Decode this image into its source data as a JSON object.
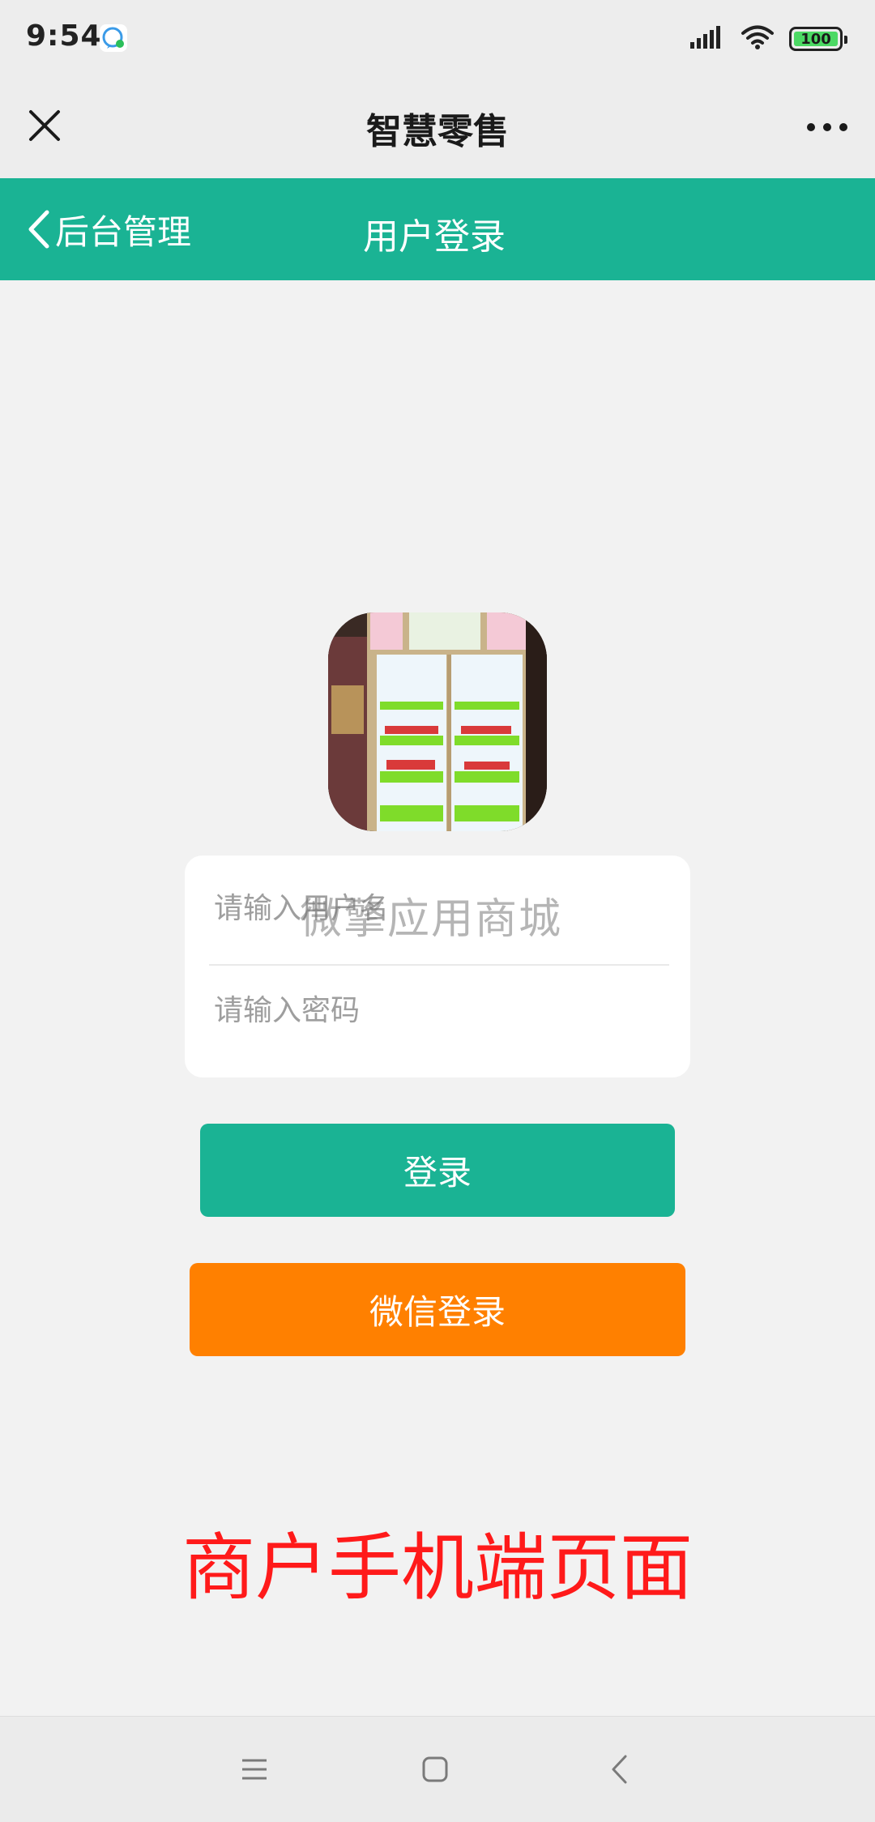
{
  "status_bar": {
    "time": "9:54",
    "battery_level": "100",
    "app_icon": "wechat-notification-icon",
    "icons": [
      "signal-icon",
      "wifi-icon",
      "battery-icon"
    ]
  },
  "title_bar": {
    "title": "智慧零售",
    "close_icon": "close-icon",
    "more_icon": "more-icon"
  },
  "header": {
    "back_label": "后台管理",
    "title": "用户登录",
    "background_color": "#1ab394"
  },
  "logo": {
    "icon": "vending-fridge-logo"
  },
  "form": {
    "username_placeholder": "请输入用户名",
    "password_placeholder": "请输入密码",
    "watermark": "微擎应用商城"
  },
  "buttons": {
    "login_label": "登录",
    "login_color": "#1ab394",
    "wechat_login_label": "微信登录",
    "wechat_login_color": "#ff8000"
  },
  "caption": {
    "text": "商户手机端页面",
    "color": "#ff1a1a"
  },
  "nav_bar": {
    "icons": [
      "menu-icon",
      "home-icon",
      "back-icon"
    ]
  }
}
